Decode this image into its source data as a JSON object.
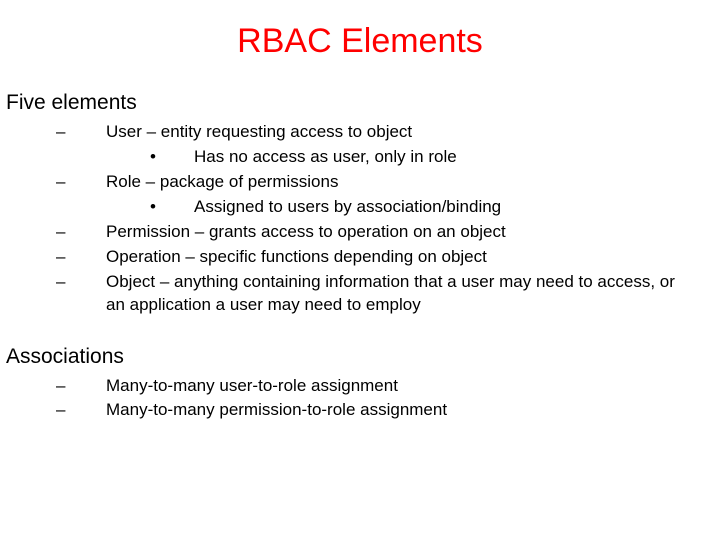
{
  "title": "RBAC Elements",
  "sections": [
    {
      "heading": "Five elements",
      "items": [
        {
          "level": 1,
          "text": "User – entity requesting access to object"
        },
        {
          "level": 2,
          "text": "Has no access as user, only in role"
        },
        {
          "level": 1,
          "text": "Role – package of permissions"
        },
        {
          "level": 2,
          "text": "Assigned to users by association/binding"
        },
        {
          "level": 1,
          "text": "Permission – grants access to operation on an object"
        },
        {
          "level": 1,
          "text": "Operation – specific functions depending on object"
        },
        {
          "level": 1,
          "text": "Object – anything containing information that a user may need to access, or an application a user may need to employ"
        }
      ]
    },
    {
      "heading": "Associations",
      "items": [
        {
          "level": 1,
          "text": "Many-to-many user-to-role assignment"
        },
        {
          "level": 1,
          "text": "Many-to-many permission-to-role assignment"
        }
      ]
    }
  ],
  "bullets": {
    "level1": "–",
    "level2": "•"
  }
}
